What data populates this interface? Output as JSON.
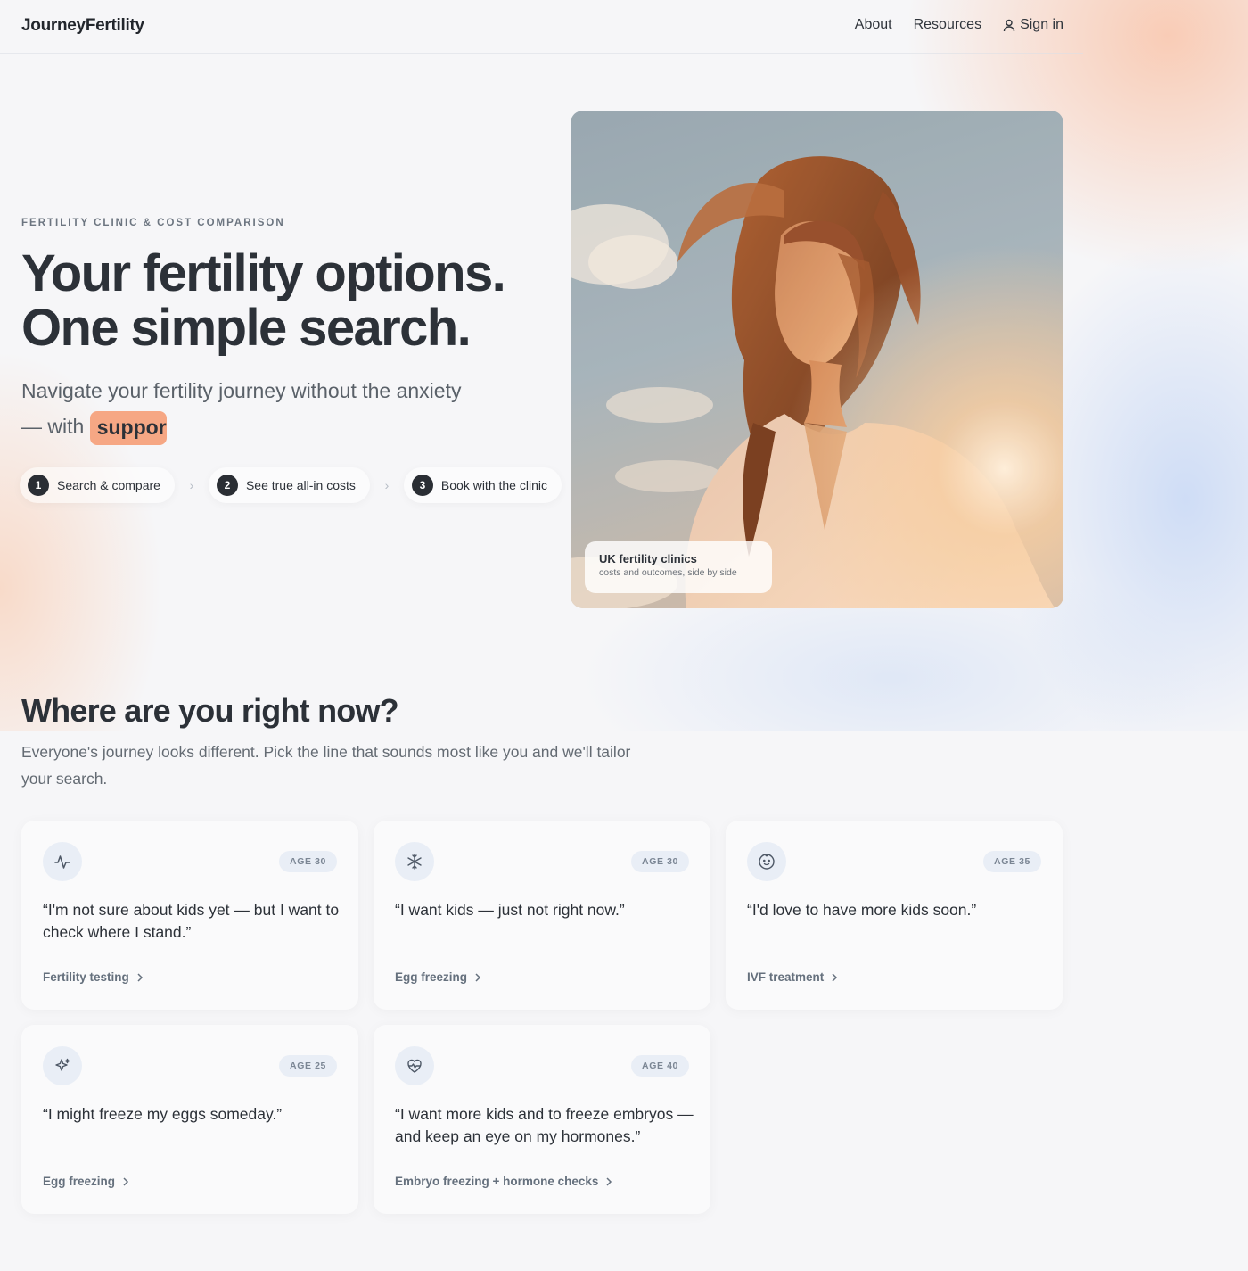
{
  "header": {
    "logo": "JourneyFertility",
    "nav": {
      "about": "About",
      "resources": "Resources",
      "sign_in": "Sign in"
    }
  },
  "hero": {
    "eyebrow": "FERTILITY CLINIC & COST COMPARISON",
    "headline_line1": "Your fertility options.",
    "headline_line2": "One simple search.",
    "subhead_line1": "Navigate your fertility journey without the anxiety",
    "subhead_line2_prefix": "— with",
    "subhead_highlight": "support",
    "steps": [
      {
        "num": "1",
        "label": "Search & compare"
      },
      {
        "num": "2",
        "label": "See true all-in costs"
      },
      {
        "num": "3",
        "label": "Book with the clinic"
      }
    ],
    "image_caption": {
      "title": "UK fertility clinics",
      "subtitle": "costs and outcomes, side by side"
    }
  },
  "section": {
    "title": "Where are you right now?",
    "subtitle": "Everyone's journey looks different. Pick the line that sounds most like you and we'll tailor your search."
  },
  "cards": [
    {
      "icon": "activity-icon",
      "age": "AGE 30",
      "quote": "“I'm not sure about kids yet — but I want to check where I stand.”",
      "link": "Fertility testing"
    },
    {
      "icon": "snowflake-icon",
      "age": "AGE 30",
      "quote": "“I want kids — just not right now.”",
      "link": "Egg freezing"
    },
    {
      "icon": "baby-face-icon",
      "age": "AGE 35",
      "quote": "“I'd love to have more kids soon.”",
      "link": "IVF treatment"
    },
    {
      "icon": "sparkles-icon",
      "age": "AGE 25",
      "quote": "“I might freeze my eggs someday.”",
      "link": "Egg freezing"
    },
    {
      "icon": "heart-pulse-icon",
      "age": "AGE 40",
      "quote": "“I want more kids and to freeze embryos — and keep an eye on my hormones.”",
      "link": "Embryo freezing + hormone checks"
    }
  ],
  "colors": {
    "accent_highlight": "#f6a784",
    "text_dark": "#2c3138",
    "badge_bg": "#e9eef6"
  }
}
